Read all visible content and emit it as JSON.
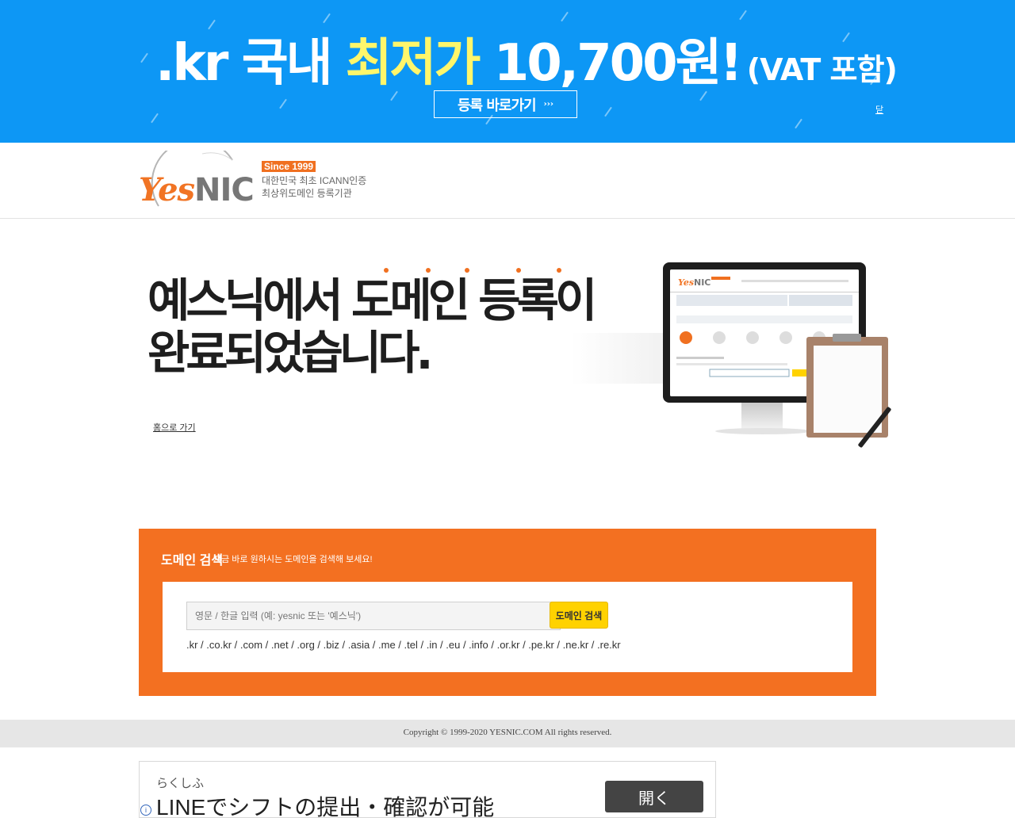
{
  "promo": {
    "part1": ".kr 국내 ",
    "highlight": "최저가",
    "price": " 10,700원!",
    "vat": "(VAT 포함)",
    "button_label": "등록 바로가기",
    "button_arrow": "›››",
    "close_label": "닫"
  },
  "header": {
    "logo_yes": "Yes",
    "logo_nic": "NIC",
    "since": "Since 1999",
    "tagline_1": "대한민국 최초 ICANN인증",
    "tagline_2": "최상위도메인 등록기관"
  },
  "hero": {
    "title_line1": "예스닉에서 도메인 등록이",
    "title_line2": "완료되었습니다.",
    "home_link": "홈으로 가기"
  },
  "search": {
    "title": "도메인 검색",
    "subtitle": "지금 바로 원하시는 도메인을 검색해 보세요!",
    "input_placeholder": "영문 / 한글 입력 (예: yesnic 또는 '예스닉')",
    "button_label": "도메인 검색",
    "tlds": ".kr / .co.kr / .com / .net / .org / .biz / .asia / .me / .tel / .in / .eu / .info / .or.kr / .pe.kr / .ne.kr / .re.kr"
  },
  "footer": {
    "copyright": "Copyright © 1999-2020 YESNIC.COM All rights reserved."
  },
  "ad": {
    "brand": "らくしふ",
    "headline": "LINEでシフトの提出・確認が可能",
    "button_label": "開く",
    "info_icon": "i"
  },
  "colors": {
    "promo_bg": "#0d97f5",
    "accent_orange": "#f37021",
    "search_button": "#ffd200"
  }
}
